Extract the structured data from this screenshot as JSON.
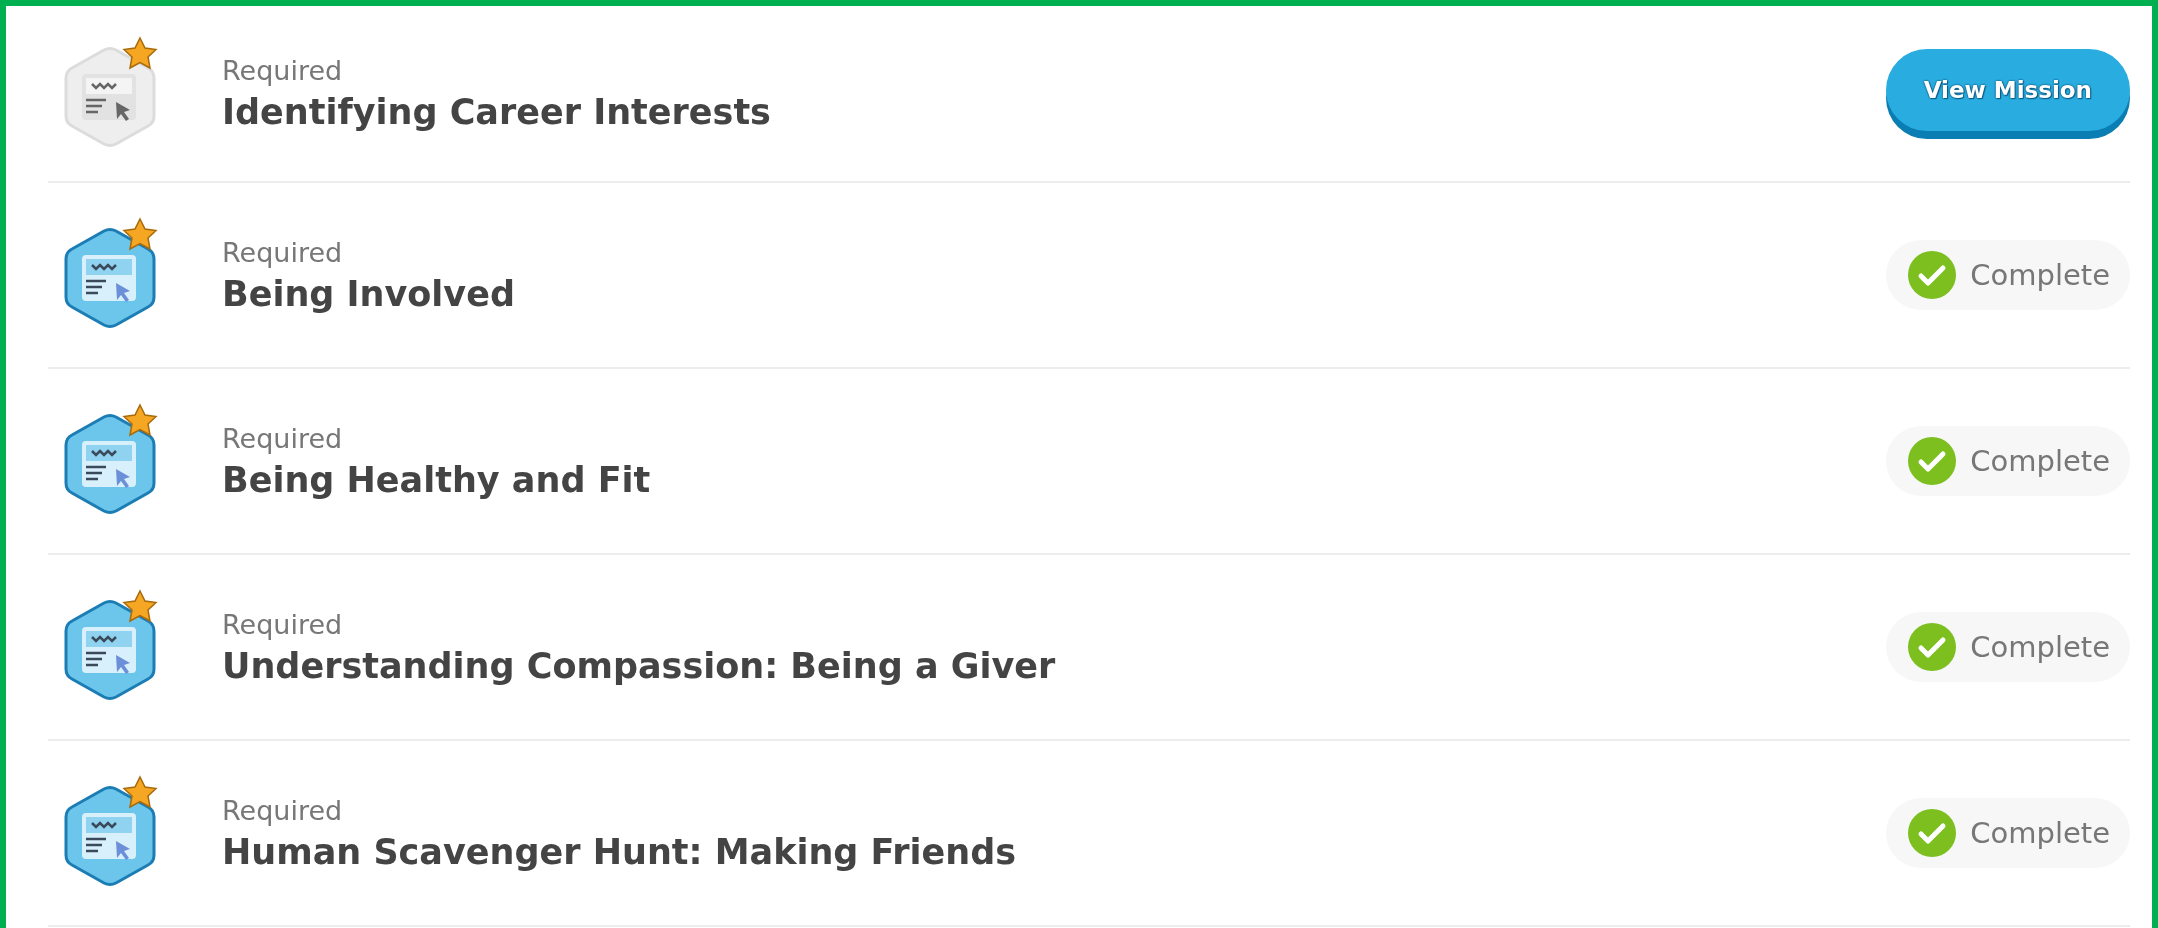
{
  "missions": [
    {
      "label": "Required",
      "title": "Identifying Career Interests",
      "kind": "open",
      "status_text": "View Mission"
    },
    {
      "label": "Required",
      "title": "Being Involved",
      "kind": "complete",
      "status_text": "Complete"
    },
    {
      "label": "Required",
      "title": "Being Healthy and Fit",
      "kind": "complete",
      "status_text": "Complete"
    },
    {
      "label": "Required",
      "title": "Understanding Compassion: Being a Giver",
      "kind": "complete",
      "status_text": "Complete"
    },
    {
      "label": "Required",
      "title": "Human Scavenger Hunt: Making Friends",
      "kind": "complete",
      "status_text": "Complete"
    }
  ]
}
